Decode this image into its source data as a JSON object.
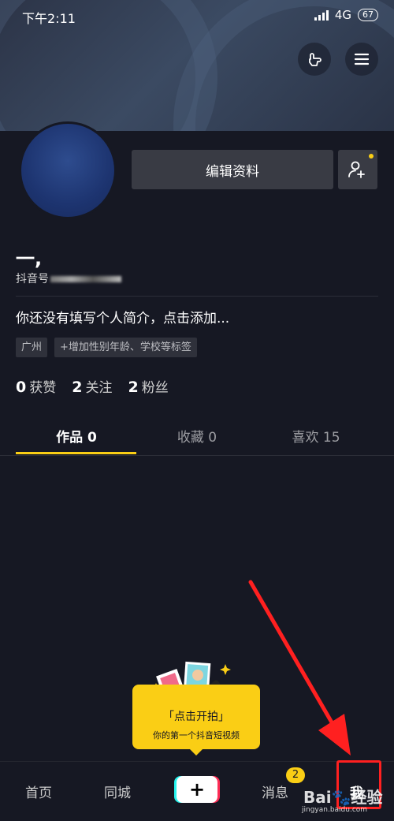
{
  "status_bar": {
    "time": "下午2:11",
    "network": "4G",
    "battery": "67"
  },
  "profile": {
    "edit_button": "编辑资料",
    "nickname": "一,",
    "douyin_id_label": "抖音号",
    "bio": "你还没有填写个人简介，点击添加...",
    "tags": [
      "广州",
      "+增加性别年龄、学校等标签"
    ]
  },
  "stats": [
    {
      "value": "0",
      "label": "获赞"
    },
    {
      "value": "2",
      "label": "关注"
    },
    {
      "value": "2",
      "label": "粉丝"
    }
  ],
  "tabs": [
    {
      "label": "作品 0",
      "active": true
    },
    {
      "label": "收藏 0",
      "active": false
    },
    {
      "label": "喜欢 15",
      "active": false
    }
  ],
  "tooltip": {
    "title": "「点击开拍」",
    "subtitle": "你的第一个抖音短视频"
  },
  "bottom_nav": {
    "home": "首页",
    "nearby": "同城",
    "create": "+",
    "messages": "消息",
    "messages_badge": "2",
    "me": "我"
  },
  "watermark": {
    "brand": "Bai🐾经验",
    "url": "jingyan.baidu.com"
  },
  "colors": {
    "accent": "#face15",
    "background": "#161823",
    "annotation": "#ff2020"
  }
}
